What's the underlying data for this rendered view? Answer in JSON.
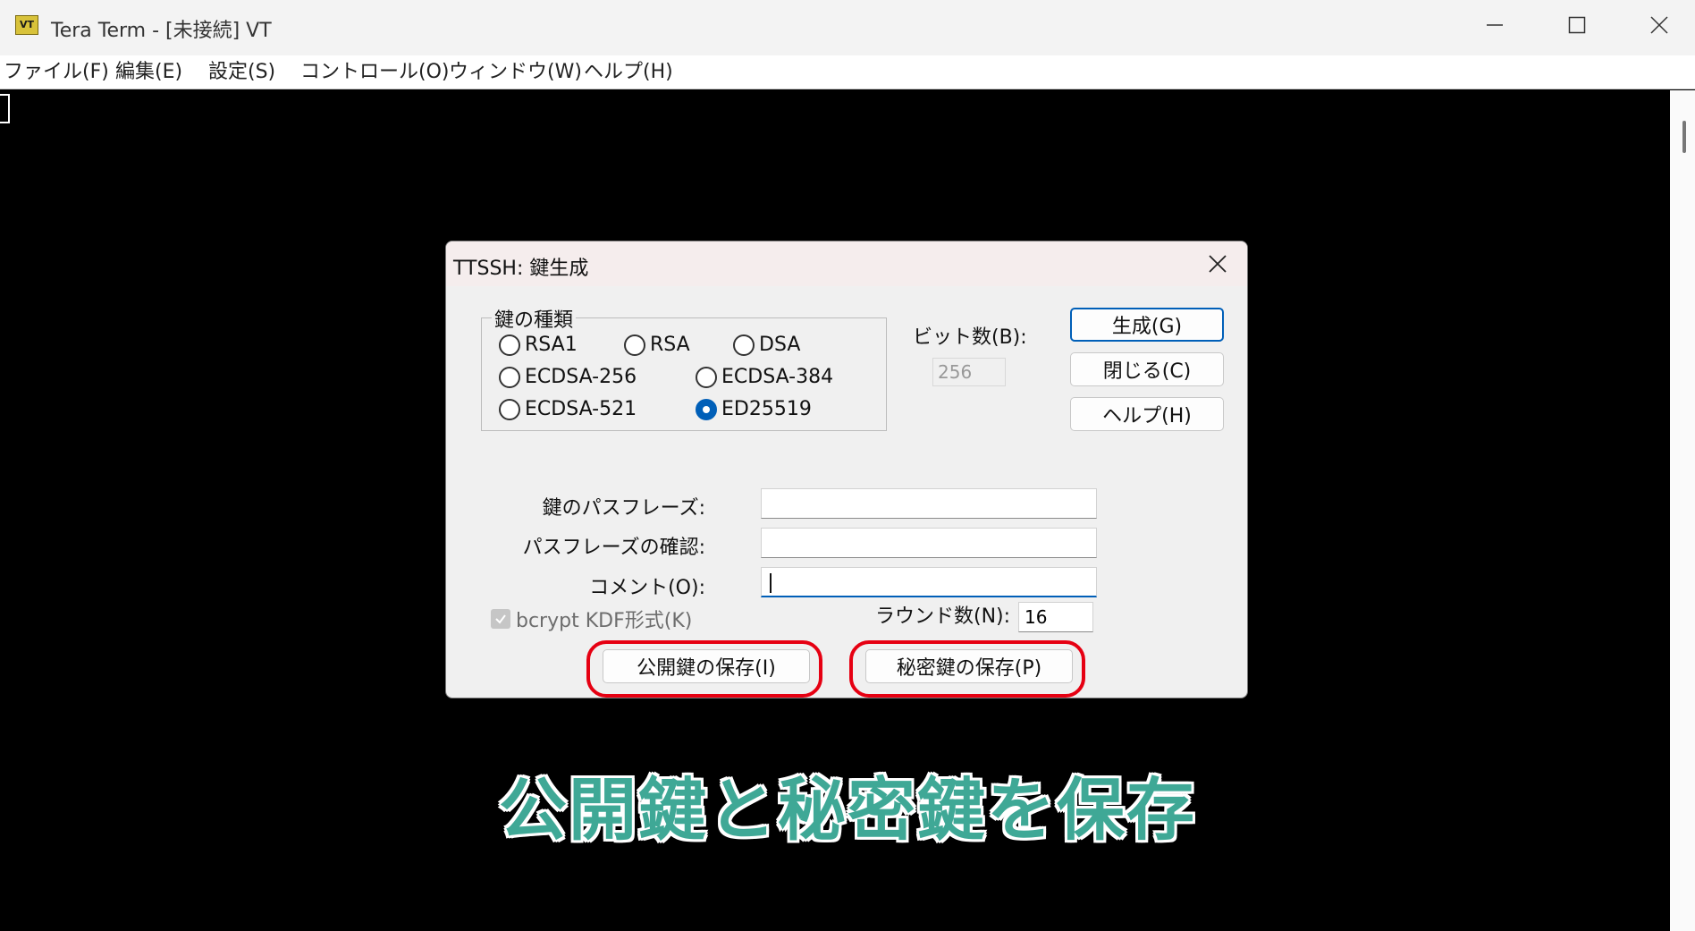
{
  "window": {
    "title": "Tera Term - [未接続] VT",
    "icon_text": "VT"
  },
  "menu": {
    "items": [
      {
        "label": "ファイル(F)"
      },
      {
        "label": "編集(E)"
      },
      {
        "label": "設定(S)"
      },
      {
        "label": "コントロール(O)"
      },
      {
        "label": "ウィンドウ(W)"
      },
      {
        "label": "ヘルプ(H)"
      }
    ]
  },
  "dialog": {
    "title": "TTSSH: 鍵生成",
    "key_type": {
      "legend": "鍵の種類",
      "options": [
        {
          "label": "RSA1",
          "checked": false
        },
        {
          "label": "RSA",
          "checked": false
        },
        {
          "label": "DSA",
          "checked": false
        },
        {
          "label": "ECDSA-256",
          "checked": false
        },
        {
          "label": "ECDSA-384",
          "checked": false
        },
        {
          "label": "ECDSA-521",
          "checked": false
        },
        {
          "label": "ED25519",
          "checked": true
        }
      ]
    },
    "bits_label": "ビット数(B):",
    "bits_value": "256",
    "buttons": {
      "generate": "生成(G)",
      "close": "閉じる(C)",
      "help": "ヘルプ(H)"
    },
    "passphrase_label": "鍵のパスフレーズ:",
    "passphrase_value": "",
    "confirm_label": "パスフレーズの確認:",
    "confirm_value": "",
    "comment_label": "コメント(O):",
    "comment_value": "",
    "bcrypt_label": "bcrypt KDF形式(K)",
    "bcrypt_checked": true,
    "rounds_label": "ラウンド数(N):",
    "rounds_value": "16",
    "save_public": "公開鍵の保存(I)",
    "save_private": "秘密鍵の保存(P)"
  },
  "caption": "公開鍵と秘密鍵を保存",
  "colors": {
    "highlight": "#e60012",
    "caption": "#3fa896",
    "accent": "#005fb8"
  }
}
